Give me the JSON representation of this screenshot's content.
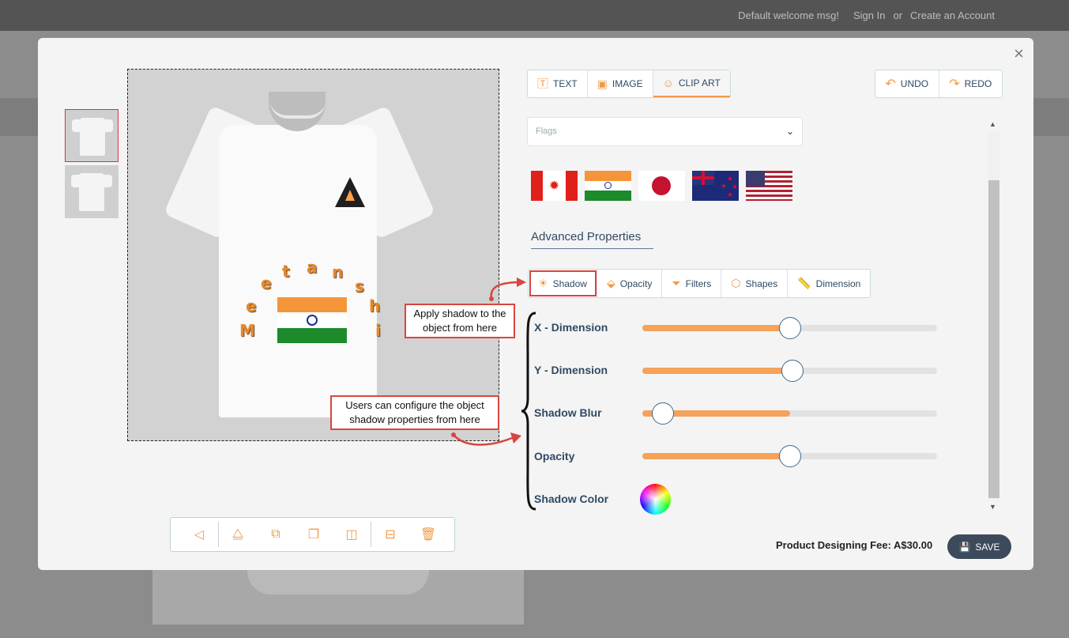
{
  "topbar": {
    "welcome": "Default welcome msg!",
    "sign_in": "Sign In",
    "or": "or",
    "create_account": "Create an Account"
  },
  "modal": {
    "close": "×"
  },
  "design": {
    "letters": [
      "M",
      "e",
      "e",
      "t",
      "a",
      "n",
      "s",
      "h",
      "i"
    ]
  },
  "tabs": [
    {
      "label": "TEXT",
      "icon": "text-icon"
    },
    {
      "label": "IMAGE",
      "icon": "image-icon"
    },
    {
      "label": "CLIP ART",
      "icon": "clipart-icon"
    }
  ],
  "undo_label": "UNDO",
  "redo_label": "REDO",
  "category_select": {
    "value": "Flags"
  },
  "flags": [
    "canada-flag",
    "india-flag",
    "japan-flag",
    "new-zealand-flag",
    "usa-flag"
  ],
  "advanced": {
    "title": "Advanced Properties"
  },
  "subtabs": [
    {
      "label": "Shadow",
      "icon": "sun-icon"
    },
    {
      "label": "Opacity",
      "icon": "drop-icon"
    },
    {
      "label": "Filters",
      "icon": "funnel-icon"
    },
    {
      "label": "Shapes",
      "icon": "hexagon-icon"
    },
    {
      "label": "Dimension",
      "icon": "ruler-icon"
    }
  ],
  "shadow": {
    "x_label": "X - Dimension",
    "x_value": 0.5,
    "y_label": "Y - Dimension",
    "y_value": 0.51,
    "blur_label": "Shadow Blur",
    "blur_value": 0.07,
    "opacity_label": "Opacity",
    "opacity_value": 0.5,
    "color_label": "Shadow Color"
  },
  "fee": "Product Designing Fee: A$30.00",
  "save_label": "SAVE",
  "annotations": {
    "shadow_tab": "Apply shadow to the object from here",
    "shadow_props": "Users can configure the object shadow properties from here"
  },
  "colors": {
    "accent": "#f19a48",
    "callout_border": "#d9453f",
    "text_dark": "#2f4a63"
  }
}
